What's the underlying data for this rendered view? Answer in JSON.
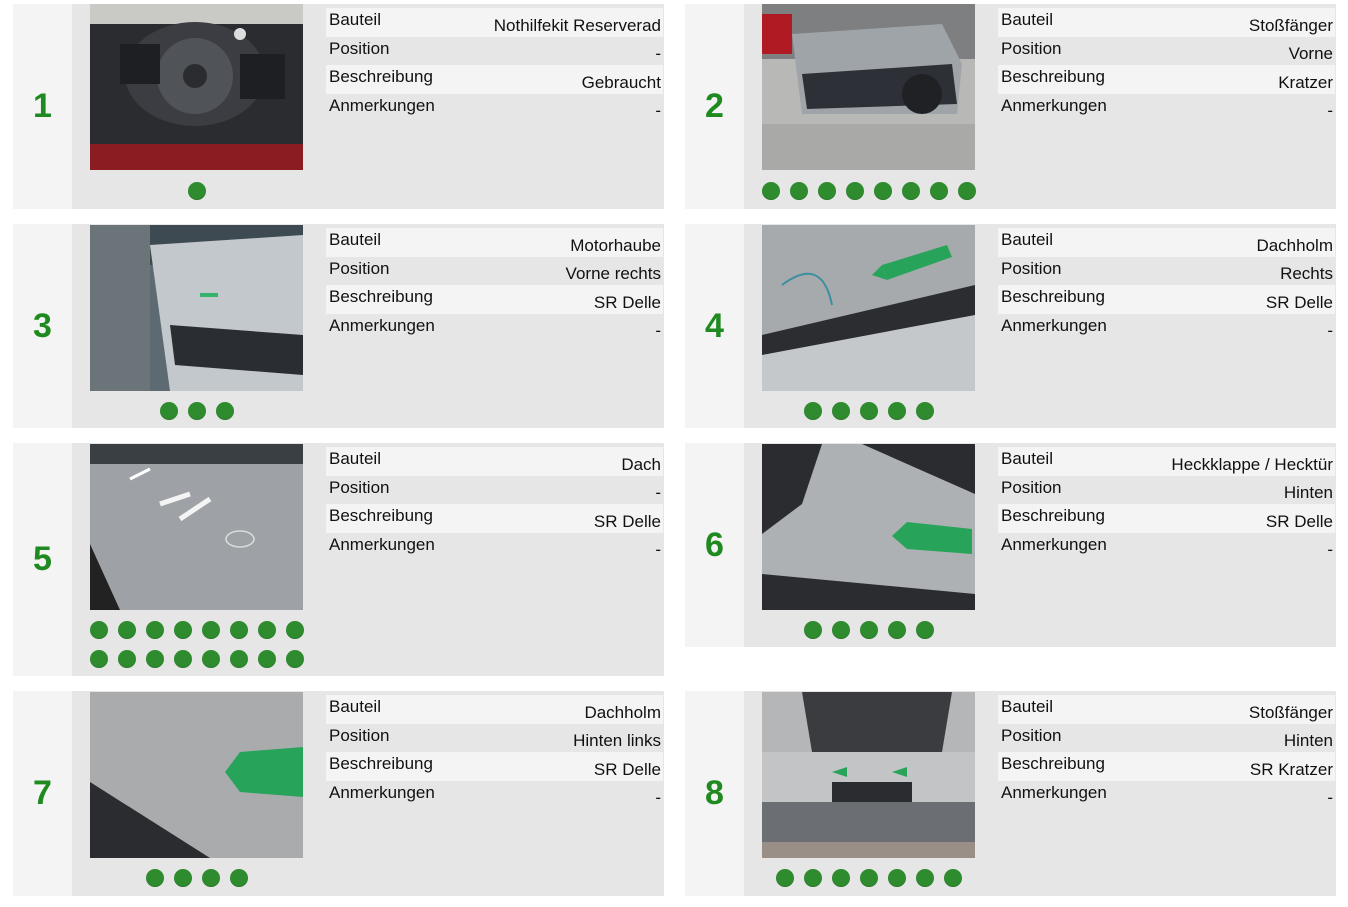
{
  "labels": {
    "bauteil": "Bauteil",
    "position": "Position",
    "beschreibung": "Beschreibung",
    "anmerkungen": "Anmerkungen"
  },
  "damages": [
    {
      "number": "1",
      "bauteil": "Nothilfekit Reserverad",
      "position": "-",
      "beschreibung": "Gebraucht",
      "anmerkungen": "-",
      "photo_count": 1
    },
    {
      "number": "2",
      "bauteil": "Stoßfänger",
      "position": "Vorne",
      "beschreibung": "Kratzer",
      "anmerkungen": "-",
      "photo_count": 8
    },
    {
      "number": "3",
      "bauteil": "Motorhaube",
      "position": "Vorne rechts",
      "beschreibung": "SR Delle",
      "anmerkungen": "-",
      "photo_count": 3
    },
    {
      "number": "4",
      "bauteil": "Dachholm",
      "position": "Rechts",
      "beschreibung": "SR Delle",
      "anmerkungen": "-",
      "photo_count": 5
    },
    {
      "number": "5",
      "bauteil": "Dach",
      "position": "-",
      "beschreibung": "SR Delle",
      "anmerkungen": "-",
      "photo_count": 16
    },
    {
      "number": "6",
      "bauteil": "Heckklappe / Hecktür",
      "position": "Hinten",
      "beschreibung": "SR Delle",
      "anmerkungen": "-",
      "photo_count": 5
    },
    {
      "number": "7",
      "bauteil": "Dachholm",
      "position": "Hinten links",
      "beschreibung": "SR Delle",
      "anmerkungen": "-",
      "photo_count": 4
    },
    {
      "number": "8",
      "bauteil": "Stoßfänger",
      "position": "Hinten",
      "beschreibung": "SR Kratzer",
      "anmerkungen": "-",
      "photo_count": 7
    }
  ],
  "colors": {
    "number": "#1f8a1f",
    "dot": "#2e8b2e",
    "card": "#e6e6e6",
    "numcol": "#f4f4f4"
  }
}
